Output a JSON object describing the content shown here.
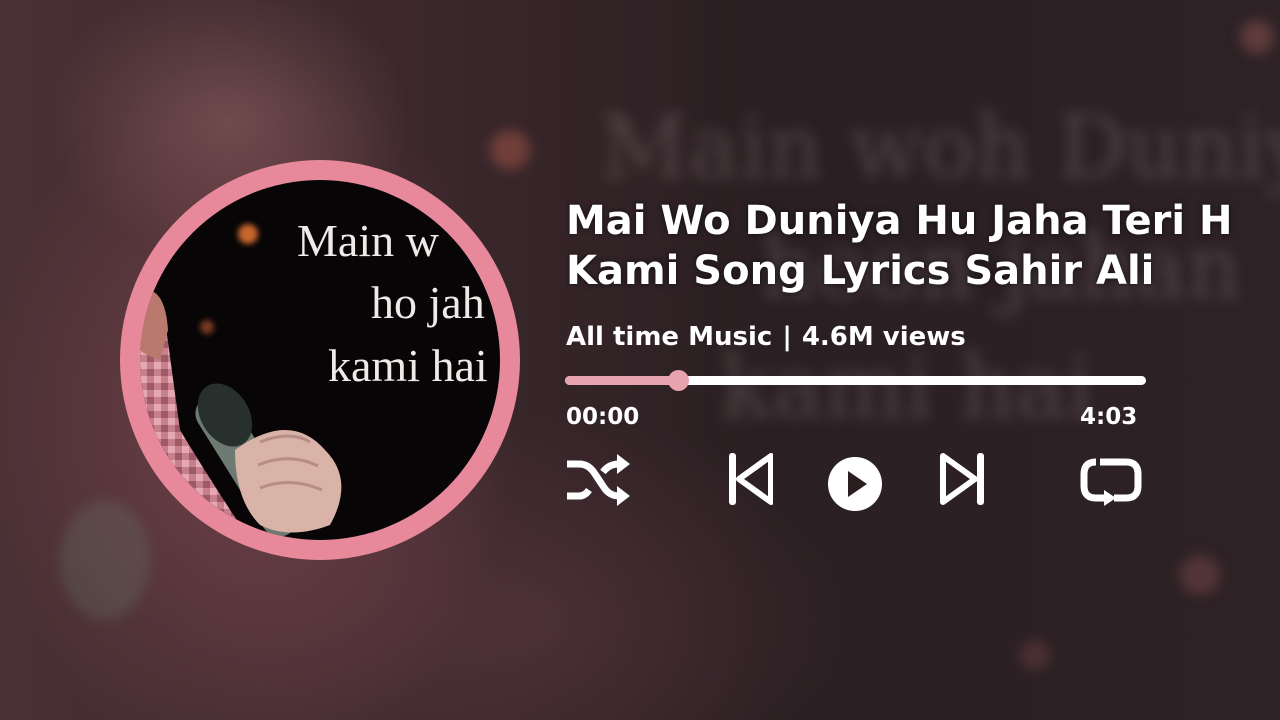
{
  "track": {
    "title_line1": "Mai Wo Duniya Hu Jaha Teri H",
    "title_line2": "Kami Song Lyrics Sahir Ali",
    "channel": "All time Music",
    "separator": "|",
    "views": "4.6M views"
  },
  "artwork": {
    "lyric_line1": "Main w",
    "lyric_line2": "ho jah",
    "lyric_line3": "kami hai",
    "ring_color": "#e7899b"
  },
  "background_lyrics": [
    "Main woh Duniya",
    "hoon jahan",
    "kami hai"
  ],
  "player": {
    "current_time": "00:00",
    "duration": "4:03",
    "progress_fraction": 0.195,
    "played_color": "#e7a3ae",
    "track_color": "#ffffff"
  },
  "controls": {
    "shuffle": "shuffle-icon",
    "previous": "skip-previous-icon",
    "play": "play-icon",
    "next": "skip-next-icon",
    "repeat": "repeat-icon"
  }
}
